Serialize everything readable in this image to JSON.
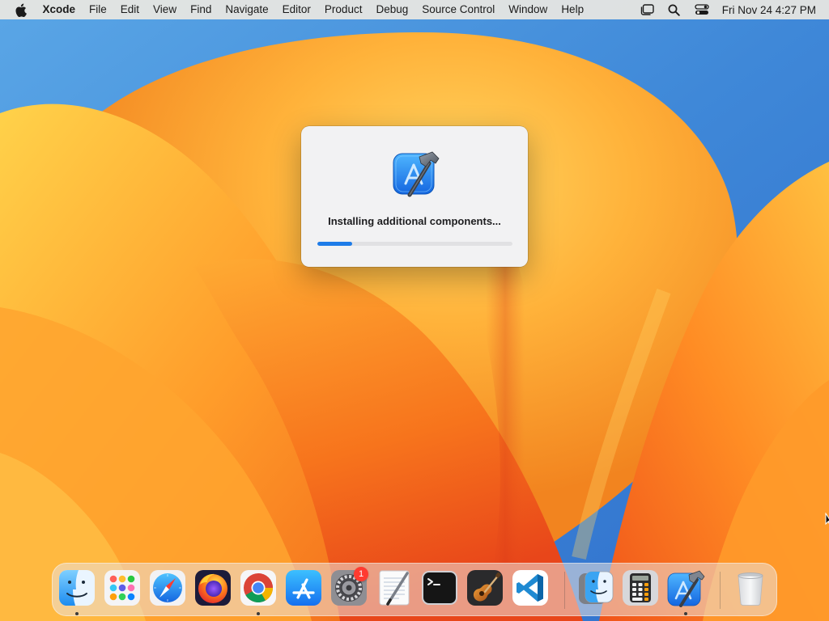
{
  "menubar": {
    "app_name": "Xcode",
    "items": [
      "File",
      "Edit",
      "View",
      "Find",
      "Navigate",
      "Editor",
      "Product",
      "Debug",
      "Source Control",
      "Window",
      "Help"
    ],
    "clock": "Fri Nov 24  4:27 PM"
  },
  "dialog": {
    "message": "Installing additional components...",
    "progress": 0.18,
    "accent": "#1e7ce8"
  },
  "dock": {
    "apps": [
      {
        "name": "Finder",
        "icon": "finder-icon",
        "running": true
      },
      {
        "name": "Launchpad",
        "icon": "launchpad-icon",
        "running": false
      },
      {
        "name": "Safari",
        "icon": "safari-icon",
        "running": false
      },
      {
        "name": "Firefox",
        "icon": "firefox-icon",
        "running": false
      },
      {
        "name": "Google Chrome",
        "icon": "chrome-icon",
        "running": true
      },
      {
        "name": "App Store",
        "icon": "app-store-icon",
        "running": false
      },
      {
        "name": "System Settings",
        "icon": "settings-icon",
        "running": false,
        "badge": "1"
      },
      {
        "name": "TextEdit",
        "icon": "textedit-icon",
        "running": false
      },
      {
        "name": "Terminal",
        "icon": "terminal-icon",
        "running": false
      },
      {
        "name": "GarageBand",
        "icon": "garageband-icon",
        "running": false
      },
      {
        "name": "Visual Studio Code",
        "icon": "vscode-icon",
        "running": false
      }
    ],
    "recents": [
      {
        "name": "Migration Assistant",
        "icon": "migration-assistant-icon",
        "running": false
      },
      {
        "name": "Calculator",
        "icon": "calculator-icon",
        "running": false
      },
      {
        "name": "Xcode",
        "icon": "xcode-icon",
        "running": true
      }
    ],
    "trash": {
      "name": "Trash",
      "icon": "trash-icon"
    }
  }
}
